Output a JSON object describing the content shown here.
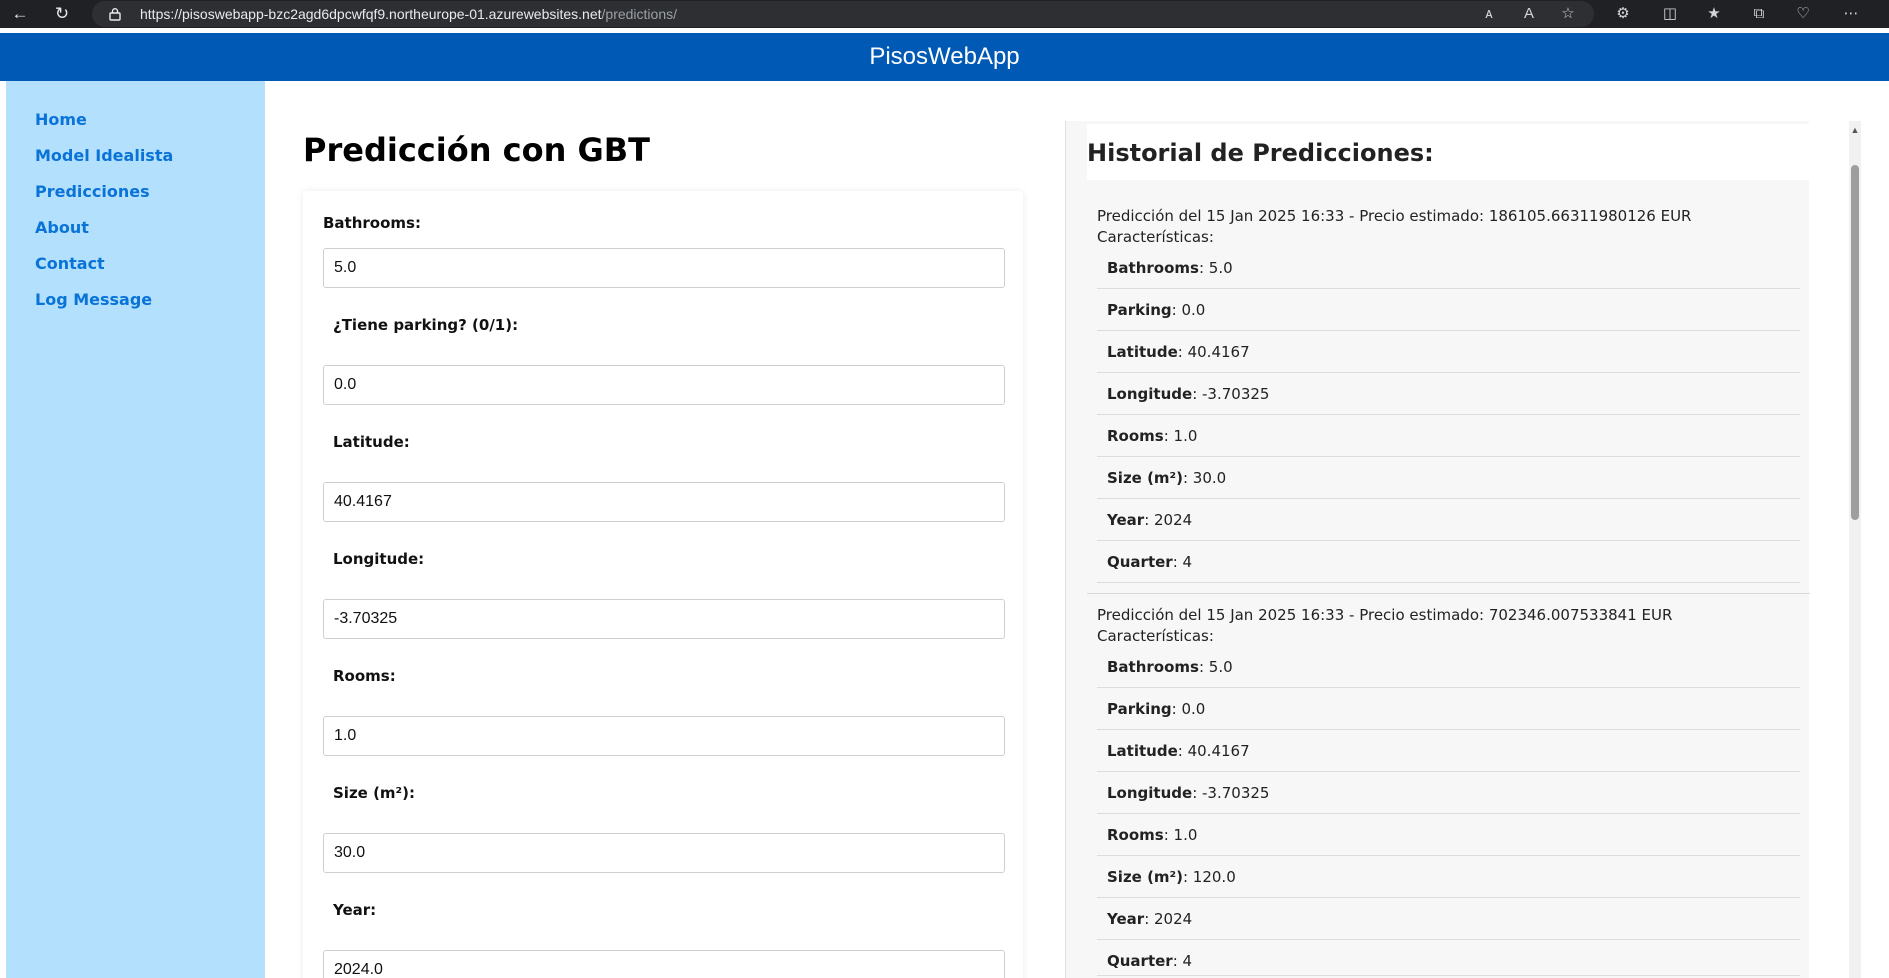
{
  "browser": {
    "url_host": "https://pisoswebapp-bzc2agd6dpcwfqf9.northeurope-01.azurewebsites.net",
    "url_path": "/predictions/"
  },
  "header": {
    "brand": "PisosWebApp"
  },
  "sidebar": {
    "items": [
      {
        "label": "Home"
      },
      {
        "label": "Model Idealista"
      },
      {
        "label": "Predicciones"
      },
      {
        "label": "About"
      },
      {
        "label": "Contact"
      },
      {
        "label": "Log Message"
      }
    ]
  },
  "main": {
    "title": "Predicción con GBT",
    "fields": [
      {
        "label": "Bathrooms:",
        "value": "5.0"
      },
      {
        "label": "¿Tiene parking? (0/1):",
        "value": "0.0"
      },
      {
        "label": "Latitude:",
        "value": "40.4167"
      },
      {
        "label": "Longitude:",
        "value": "-3.70325"
      },
      {
        "label": "Rooms:",
        "value": "1.0"
      },
      {
        "label": "Size (m²):",
        "value": "30.0"
      },
      {
        "label": "Year:",
        "value": "2024.0"
      }
    ]
  },
  "history": {
    "title": "Historial de Predicciones:",
    "entries": [
      {
        "header": "Predicción del 15 Jan 2025 16:33 - Precio estimado: 186105.66311980126 EUR",
        "caracteristicas": "Características:",
        "features": [
          {
            "name": "Bathrooms",
            "value": ": 5.0"
          },
          {
            "name": "Parking",
            "value": ": 0.0"
          },
          {
            "name": "Latitude",
            "value": ": 40.4167"
          },
          {
            "name": "Longitude",
            "value": ": -3.70325"
          },
          {
            "name": "Rooms",
            "value": ": 1.0"
          },
          {
            "name": "Size (m²)",
            "value": ": 30.0"
          },
          {
            "name": "Year",
            "value": ": 2024"
          },
          {
            "name": "Quarter",
            "value": ": 4"
          }
        ]
      },
      {
        "header": "Predicción del 15 Jan 2025 16:33 - Precio estimado: 702346.007533841 EUR",
        "caracteristicas": "Características:",
        "features": [
          {
            "name": "Bathrooms",
            "value": ": 5.0"
          },
          {
            "name": "Parking",
            "value": ": 0.0"
          },
          {
            "name": "Latitude",
            "value": ": 40.4167"
          },
          {
            "name": "Longitude",
            "value": ": -3.70325"
          },
          {
            "name": "Rooms",
            "value": ": 1.0"
          },
          {
            "name": "Size (m²)",
            "value": ": 120.0"
          },
          {
            "name": "Year",
            "value": ": 2024"
          },
          {
            "name": "Quarter",
            "value": ": 4"
          }
        ]
      }
    ]
  }
}
